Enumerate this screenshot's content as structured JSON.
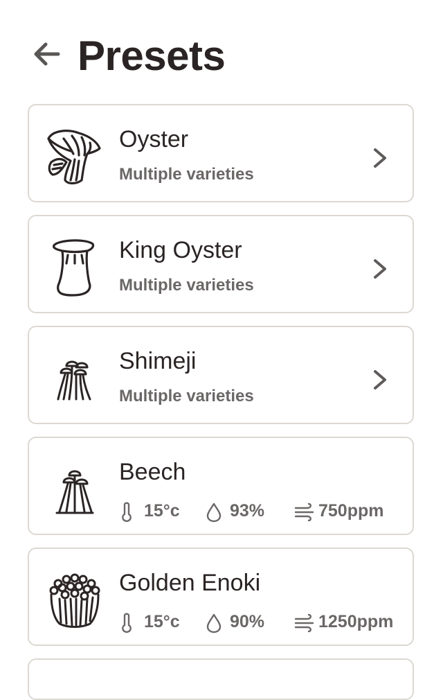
{
  "header": {
    "title": "Presets",
    "back_icon": "arrow-left-icon"
  },
  "presets": [
    {
      "name": "Oyster",
      "subtitle": "Multiple varieties",
      "icon": "oyster-mushroom-icon"
    },
    {
      "name": "King Oyster",
      "subtitle": "Multiple varieties",
      "icon": "king-oyster-mushroom-icon"
    },
    {
      "name": "Shimeji",
      "subtitle": "Multiple varieties",
      "icon": "shimeji-mushroom-icon"
    },
    {
      "name": "Beech",
      "icon": "beech-mushroom-icon",
      "stats": {
        "temperature": "15°c",
        "humidity": "93%",
        "co2": "750ppm"
      }
    },
    {
      "name": "Golden Enoki",
      "icon": "enoki-mushroom-icon",
      "stats": {
        "temperature": "15°c",
        "humidity": "90%",
        "co2": "1250ppm"
      }
    }
  ],
  "colors": {
    "text": "#2b2424",
    "muted": "#6b6767",
    "border": "#dcd8d2",
    "background": "#ffffff"
  }
}
